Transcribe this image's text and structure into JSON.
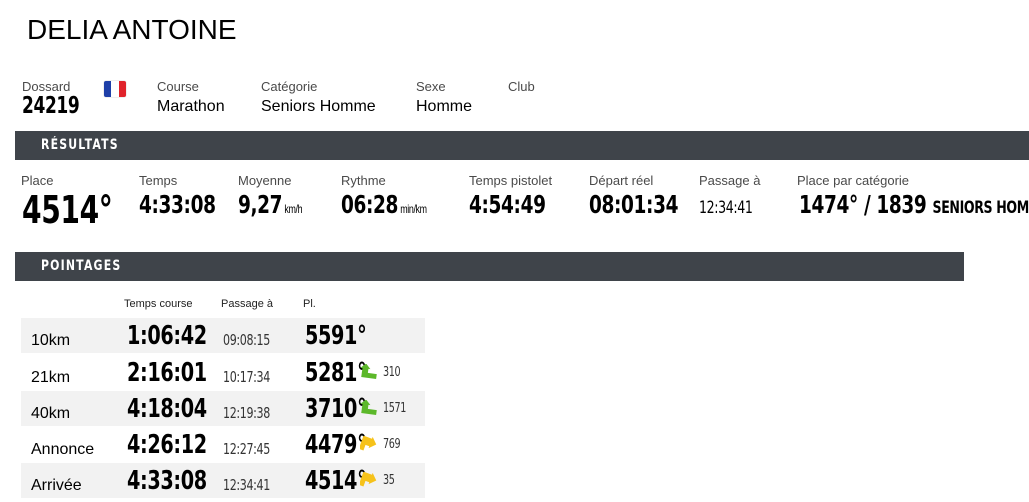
{
  "athlete": {
    "name": "DELIA ANTOINE"
  },
  "info": {
    "dossard_label": "Dossard",
    "dossard": "24219",
    "course_label": "Course",
    "course": "Marathon",
    "categorie_label": "Catégorie",
    "categorie": "Seniors Homme",
    "sexe_label": "Sexe",
    "sexe": "Homme",
    "club_label": "Club",
    "club": "",
    "flag": {
      "country": "France",
      "colors": [
        "#1e3fa8",
        "#ffffff",
        "#e0232b"
      ]
    }
  },
  "resultats": {
    "title": "RÉSULTATS",
    "place_label": "Place",
    "place": "4514°",
    "temps_label": "Temps",
    "temps": "4:33:08",
    "moyenne_label": "Moyenne",
    "moyenne": "9,27",
    "moyenne_unit": "km/h",
    "rythme_label": "Rythme",
    "rythme": "06:28",
    "rythme_unit": "min/km",
    "pistolet_label": "Temps pistolet",
    "pistolet": "4:54:49",
    "depart_label": "Départ réel",
    "depart": "08:01:34",
    "passage_label": "Passage à",
    "passage": "12:34:41",
    "cat_place_label": "Place par catégorie",
    "cat_place": "1474° / 1839",
    "cat_name": "SENIORS HOMME"
  },
  "pointages": {
    "title": "POINTAGES",
    "headers": {
      "time": "Temps course",
      "passage": "Passage à",
      "place": "Pl."
    },
    "rows": [
      {
        "name": "10km",
        "time": "1:06:42",
        "passage": "09:08:15",
        "place": "5591°",
        "trend": "none",
        "delta": ""
      },
      {
        "name": "21km",
        "time": "2:16:01",
        "passage": "10:17:34",
        "place": "5281°",
        "trend": "up",
        "delta": "310"
      },
      {
        "name": "40km",
        "time": "4:18:04",
        "passage": "12:19:38",
        "place": "3710°",
        "trend": "up",
        "delta": "1571"
      },
      {
        "name": "Annonce",
        "time": "4:26:12",
        "passage": "12:27:45",
        "place": "4479°",
        "trend": "down",
        "delta": "769"
      },
      {
        "name": "Arrivée",
        "time": "4:33:08",
        "passage": "12:34:41",
        "place": "4514°",
        "trend": "down",
        "delta": "35"
      }
    ]
  },
  "colors": {
    "bar": "#3f444a",
    "trend_up": "#5cb82a",
    "trend_down": "#f6c21a"
  }
}
